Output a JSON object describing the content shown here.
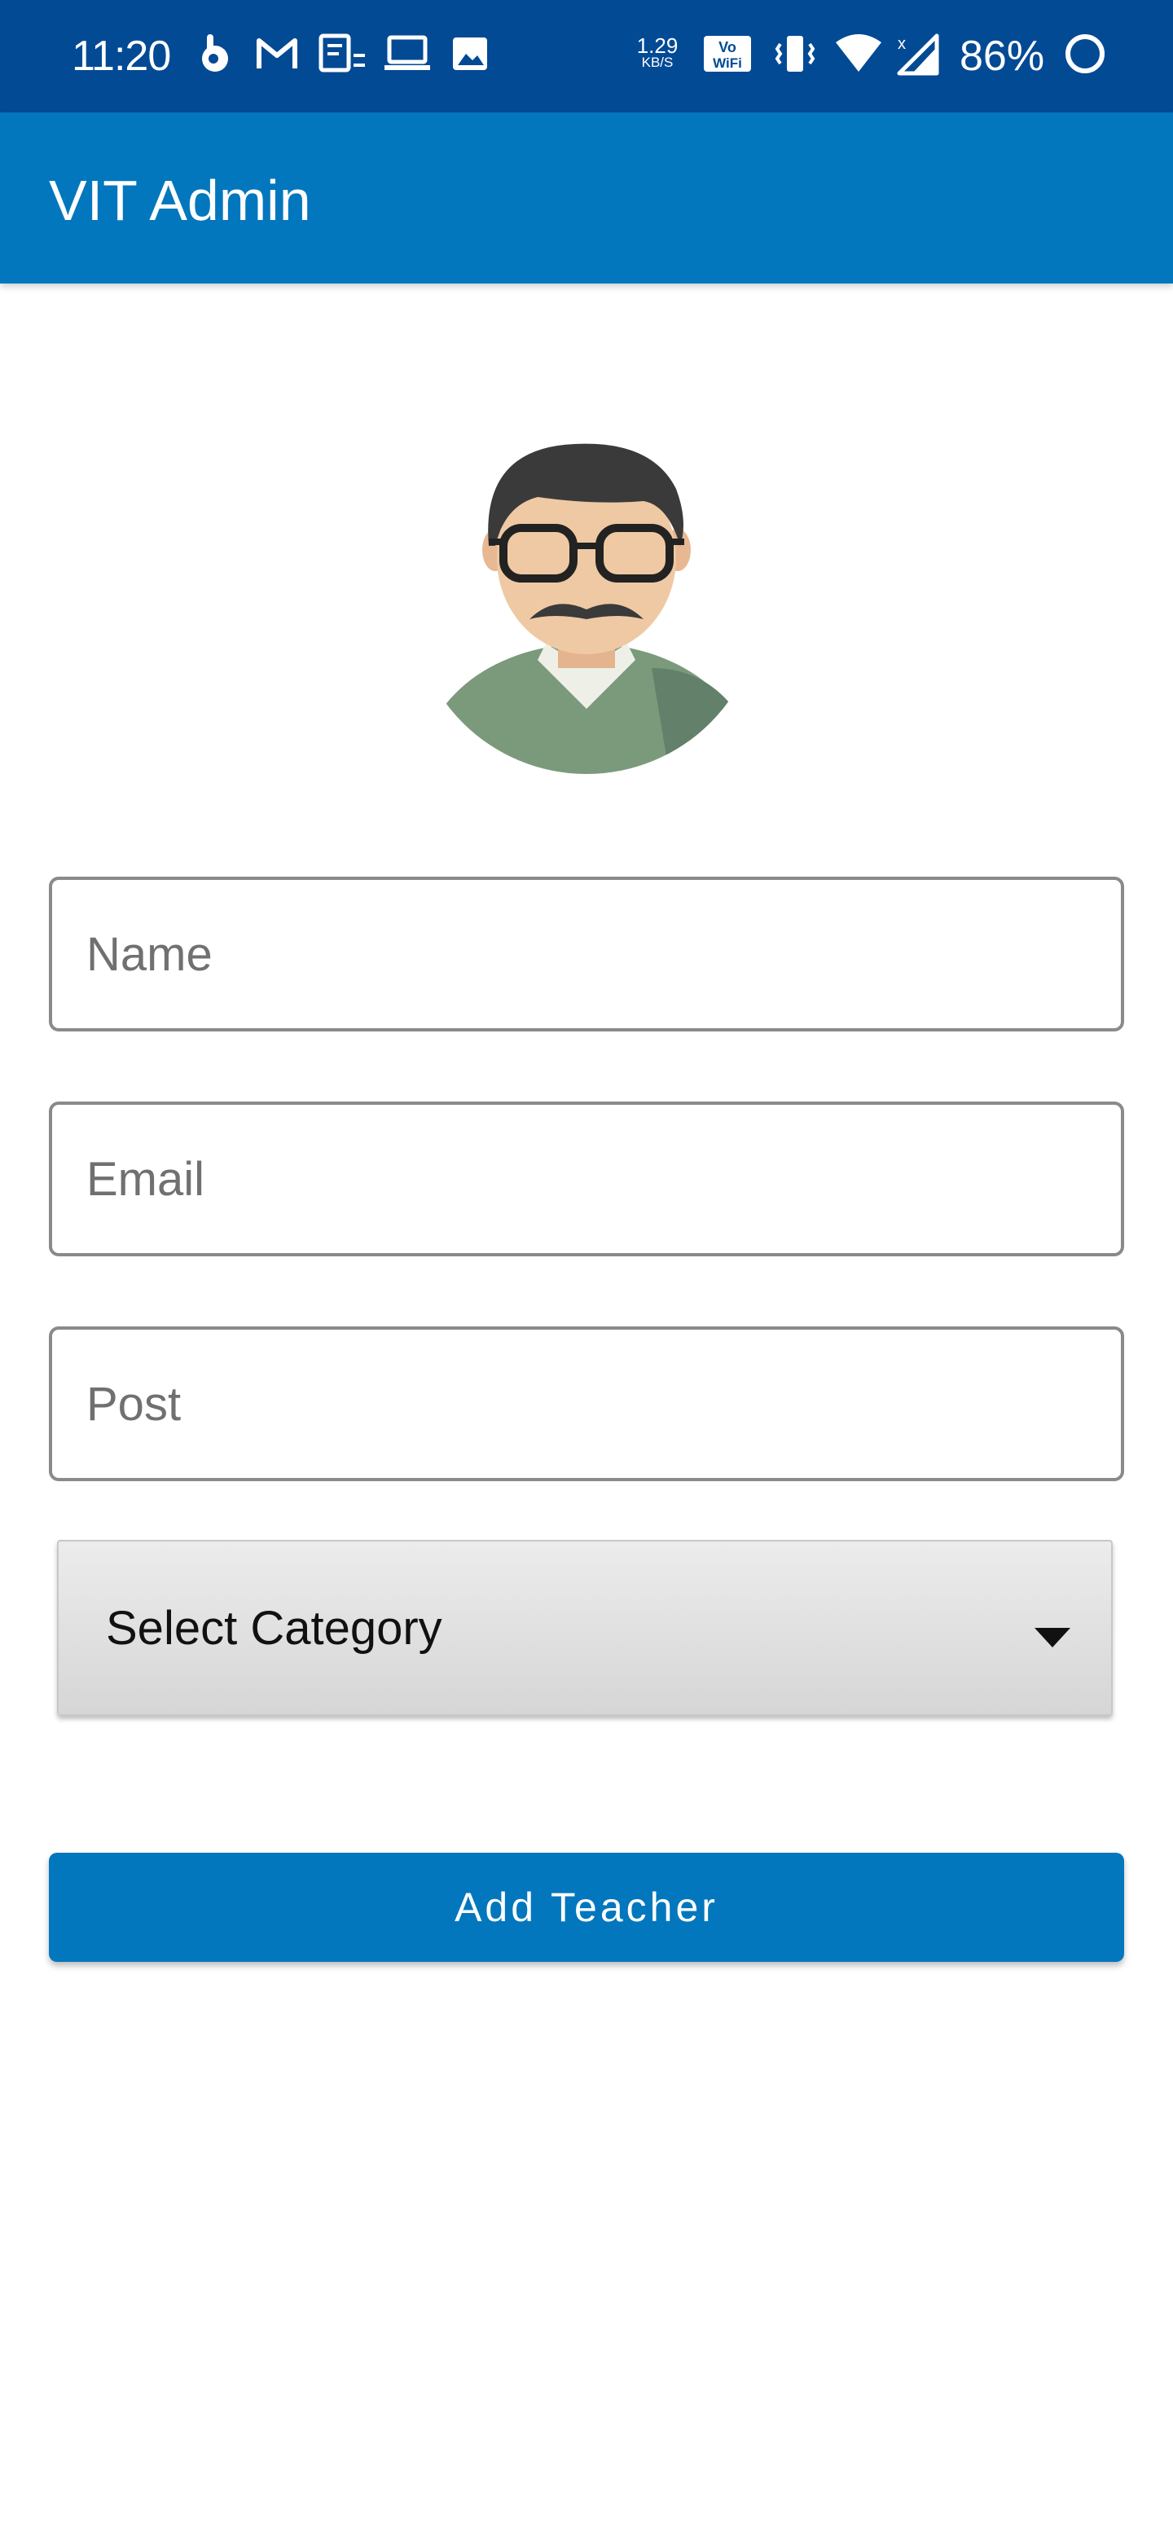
{
  "status_bar": {
    "time": "11:20",
    "net_speed_value": "1.29",
    "net_speed_unit": "KB/S",
    "battery_percent": "86%",
    "icons": [
      "hand-ok-icon",
      "gmail-icon",
      "notes-icon",
      "laptop-icon",
      "image-icon",
      "volte-wifi-icon",
      "vibrate-icon",
      "wifi-icon",
      "signal-icon",
      "battery-ring-icon"
    ]
  },
  "app_bar": {
    "title": "VIT Admin"
  },
  "form": {
    "name_placeholder": "Name",
    "email_placeholder": "Email",
    "post_placeholder": "Post",
    "category_label": "Select Category",
    "submit_label": "Add Teacher"
  },
  "colors": {
    "status_bar": "#034a95",
    "app_bar": "#0377bd",
    "button": "#0377bd",
    "avatar_sweater": "#7b9a7c",
    "avatar_skin": "#efc9a3",
    "avatar_hair": "#3a3a3a"
  }
}
